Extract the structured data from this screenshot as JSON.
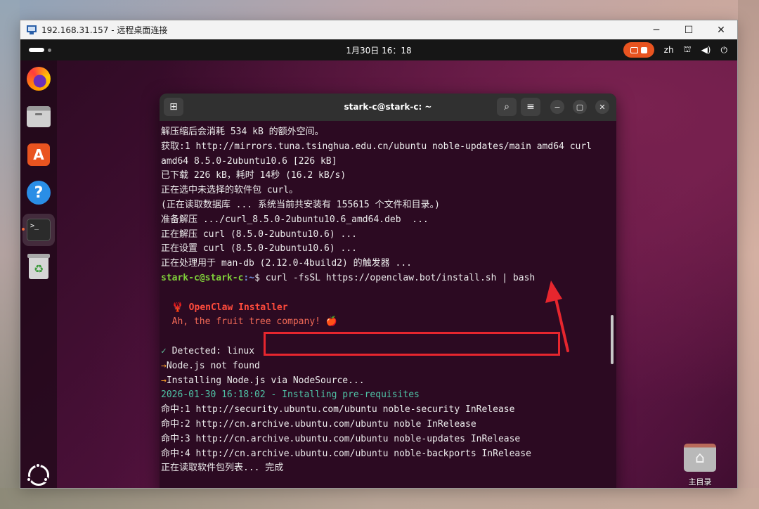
{
  "rdp": {
    "title": "192.168.31.157 - 远程桌面连接",
    "minimize": "─",
    "maximize": "☐",
    "close": "✕"
  },
  "topbar": {
    "clock": "1月30日  16：18",
    "lang": "zh",
    "network_icon": "⛫",
    "volume_icon": "◀)",
    "power_icon": "⏻"
  },
  "dock": {
    "apps": [
      "firefox",
      "files",
      "app-center",
      "help",
      "terminal",
      "trash"
    ],
    "appstore_glyph": "A",
    "help_glyph": "?",
    "terminal_glyph": ">_",
    "trash_glyph": "♻"
  },
  "desktop": {
    "home_label": "主目录",
    "home_glyph": "⌂"
  },
  "terminal": {
    "title": "stark-c@stark-c: ~",
    "new_tab_glyph": "⊞",
    "search_glyph": "⌕",
    "menu_glyph": "≡",
    "minimize_glyph": "−",
    "maximize_glyph": "▢",
    "close_glyph": "✕",
    "prompt_user": "stark-c@stark-c",
    "prompt_path": ":~",
    "prompt_symbol": "$ ",
    "command": "curl -fsSL https://openclaw.bot/install.sh | bash",
    "lines_before": [
      "解压缩后会消耗 534 kB 的额外空间。",
      "获取:1 http://mirrors.tuna.tsinghua.edu.cn/ubuntu noble-updates/main amd64 curl",
      "amd64 8.5.0-2ubuntu10.6 [226 kB]",
      "已下载 226 kB，耗时 14秒 (16.2 kB/s)",
      "正在选中未选择的软件包 curl。",
      "(正在读取数据库 ... 系统当前共安装有 155615 个文件和目录。)",
      "准备解压 .../curl_8.5.0-2ubuntu10.6_amd64.deb  ...",
      "正在解压 curl (8.5.0-2ubuntu10.6) ...",
      "正在设置 curl (8.5.0-2ubuntu10.6) ...",
      "正在处理用于 man-db (2.12.0-4build2) 的触发器 ..."
    ],
    "installer_icon": "🦞",
    "installer_title": "OpenClaw Installer",
    "installer_tagline": "Ah, the fruit tree company! 🍎",
    "check_mark": "✓",
    "detected": " Detected: linux",
    "arrow_mark": "→",
    "node_not_found": "Node.js not found",
    "installing_node": "Installing Node.js via NodeSource...",
    "prereq_line": "2026-01-30 16:18:02 - Installing pre-requisites",
    "lines_after": [
      "命中:1 http://security.ubuntu.com/ubuntu noble-security InRelease",
      "命中:2 http://cn.archive.ubuntu.com/ubuntu noble InRelease",
      "命中:3 http://cn.archive.ubuntu.com/ubuntu noble-updates InRelease",
      "命中:4 http://cn.archive.ubuntu.com/ubuntu noble-backports InRelease",
      "正在读取软件包列表... 完成"
    ]
  },
  "colors": {
    "accent_orange": "#e95420",
    "highlight_red": "#e7262e",
    "prompt_green": "#7fcf3a",
    "prompt_blue": "#6f8fdc"
  }
}
